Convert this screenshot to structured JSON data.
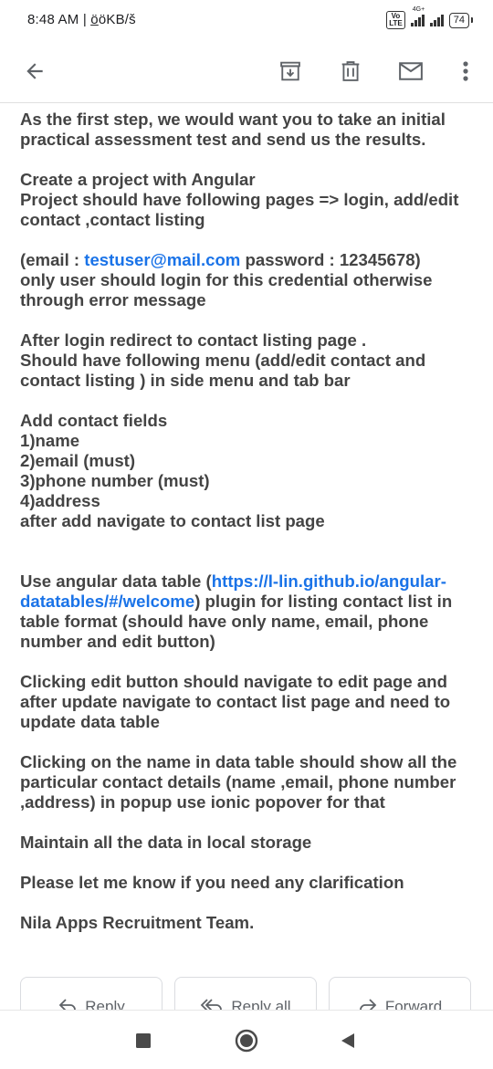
{
  "status_bar": {
    "time": "8:48 AM",
    "extra": "| ö̲öKB/š",
    "network": "4G+",
    "volte": "Vo LTE",
    "battery": "74"
  },
  "toolbar": {
    "back_icon": "arrow-left-icon",
    "archive_icon": "archive-icon",
    "delete_icon": "trash-icon",
    "mark_unread_icon": "mail-icon",
    "more_icon": "more-vertical-icon"
  },
  "email": {
    "intro": [
      "As the first step, we would want you to take an initial",
      "practical assessment test and send us the results."
    ],
    "project": [
      "Create a project with Angular",
      "Project should have following pages => login, add/edit",
      "contact ,contact listing"
    ],
    "credentials": {
      "prefix": "(email : ",
      "email_link": "testuser@mail.com",
      "suffix": " password : 12345678)",
      "lines": [
        "only user should login for this credential otherwise",
        "through error message"
      ]
    },
    "after_login": [
      "After login redirect to contact listing page .",
      "Should have following menu  (add/edit  contact and",
      "contact listing ) in side menu and tab bar"
    ],
    "add_contact": [
      "Add contact  fields",
      "1)name",
      "2)email (must)",
      "3)phone number (must)",
      "4)address",
      "after add navigate to contact list page"
    ],
    "datatable": {
      "prefix": "Use angular data table (",
      "link_part1": "https://l-lin.github.io/angular-",
      "link_part2": "datatables/#/welcome",
      "suffix": ") plugin for listing contact list in",
      "lines": [
        "table format (should have only name, email, phone",
        "number and edit button)"
      ]
    },
    "edit": [
      "Clicking edit button should navigate to edit page and",
      "after update navigate to  contact list page and need to",
      "update data table"
    ],
    "popup": [
      "Clicking on the name in data table should show all  the",
      "particular contact details (name ,email, phone number",
      ",address) in popup use ionic popover for that"
    ],
    "storage": "Maintain all the data in local storage",
    "clarify": "Please let me know if you need any clarification",
    "signature": "Nila Apps Recruitment Team."
  },
  "actions": {
    "reply": "Reply",
    "reply_all": "Reply all",
    "forward": "Forward"
  },
  "nav": {
    "recents": "square-icon",
    "home": "circle-icon",
    "back": "triangle-back-icon"
  }
}
